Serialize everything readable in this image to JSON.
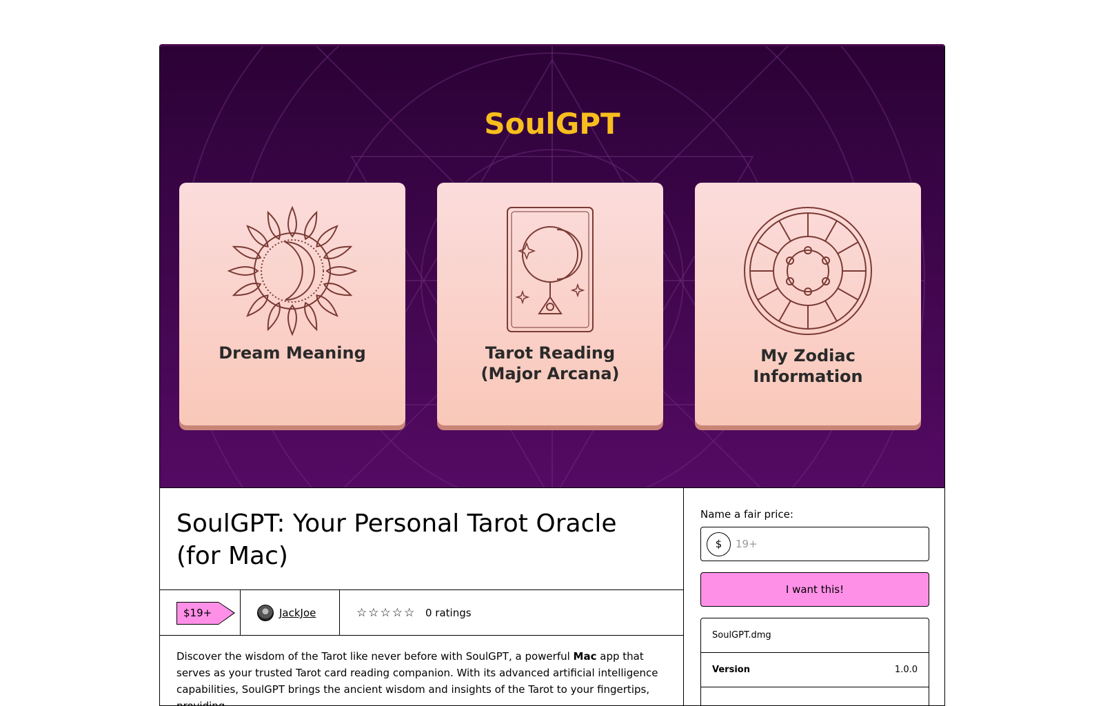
{
  "hero": {
    "app_title": "SoulGPT",
    "features": [
      {
        "label_lines": [
          "Dream Meaning"
        ]
      },
      {
        "label_lines": [
          "Tarot Reading",
          "(Major Arcana)"
        ]
      },
      {
        "label_lines": [
          "My Zodiac",
          "Information"
        ]
      }
    ]
  },
  "product": {
    "title": "SoulGPT: Your Personal Tarot Oracle (for Mac)",
    "price_badge": "$19+",
    "creator": "JackJoe",
    "stars": "☆☆☆☆☆",
    "ratings": "0 ratings",
    "description": {
      "before": "Discover the wisdom of the Tarot like never before with SoulGPT, a powerful ",
      "bold": "Mac",
      "after": " app that serves as your trusted Tarot card reading companion. With its advanced artificial intelligence capabilities, SoulGPT brings the ancient wisdom and insights of the Tarot to your fingertips, providing"
    }
  },
  "purchase": {
    "fair_price_label": "Name a fair price:",
    "currency_symbol": "$",
    "price_placeholder": "19+",
    "buy_label": "I want this!",
    "file_name": "SoulGPT.dmg",
    "version_label": "Version",
    "version_value": "1.0.0"
  },
  "colors": {
    "accent_pink": "#ff90e8",
    "hero_purple": "#3a0840",
    "hero_gold": "#f8be1d"
  }
}
